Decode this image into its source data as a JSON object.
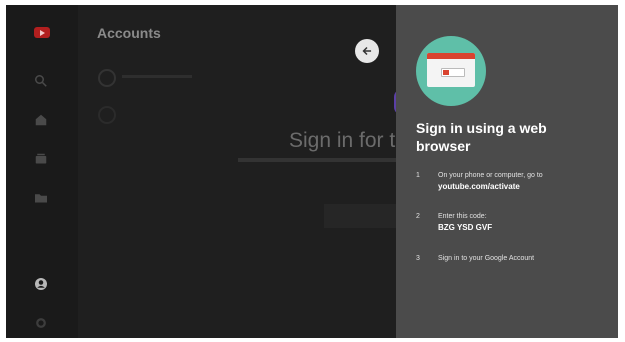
{
  "main": {
    "title": "Accounts",
    "signin_partial": "Sign in for tl"
  },
  "panel": {
    "heading": "Sign in using a web browser",
    "steps": [
      {
        "num": "1",
        "text": "On your phone or computer, go to",
        "strong": "youtube.com/activate"
      },
      {
        "num": "2",
        "text": "Enter this code:",
        "strong": "BZG YSD GVF"
      },
      {
        "num": "3",
        "text": "Sign in to your Google Account",
        "strong": ""
      }
    ]
  },
  "colors": {
    "screen_bg": "#1f1f1f",
    "panel_bg": "#4b4b4b",
    "badge": "#5fbfa8",
    "youtube_red": "#d9432f"
  },
  "icons": [
    "youtube-logo-icon",
    "search-icon",
    "home-icon",
    "subscriptions-icon",
    "library-icon",
    "account-icon",
    "settings-icon",
    "back-arrow-icon"
  ]
}
